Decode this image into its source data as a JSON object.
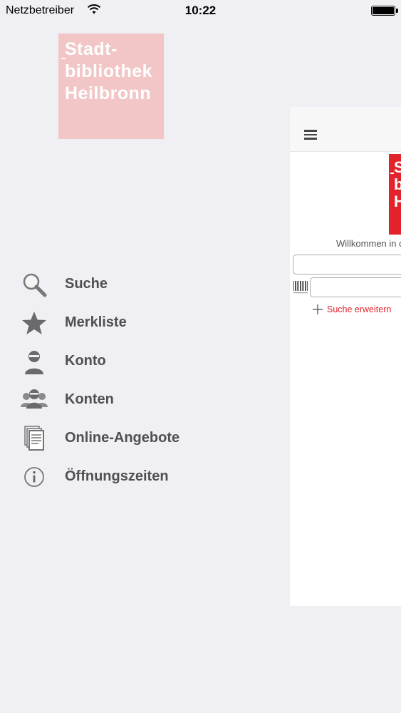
{
  "status_bar": {
    "carrier": "Netzbetreiber",
    "time": "10:22"
  },
  "drawer": {
    "logo_lines": [
      "Stadt-",
      "bibliothek",
      "Heilbronn"
    ],
    "logo_color": "#f2c6c6",
    "menu": [
      {
        "label": "Suche",
        "icon": "search-icon"
      },
      {
        "label": "Merkliste",
        "icon": "star-icon"
      },
      {
        "label": "Konto",
        "icon": "person-icon"
      },
      {
        "label": "Konten",
        "icon": "people-icon"
      },
      {
        "label": "Online-Angebote",
        "icon": "documents-icon"
      },
      {
        "label": "Öffnungszeiten",
        "icon": "info-icon"
      }
    ]
  },
  "panel": {
    "logo_lines": [
      "S",
      "b",
      "H"
    ],
    "logo_color": "#e3232b",
    "welcome": "Willkommen in d",
    "search_placeholder": "",
    "barcode_placeholder": "",
    "expand_label": "Suche erweitern",
    "accent_color": "#e3232b"
  }
}
